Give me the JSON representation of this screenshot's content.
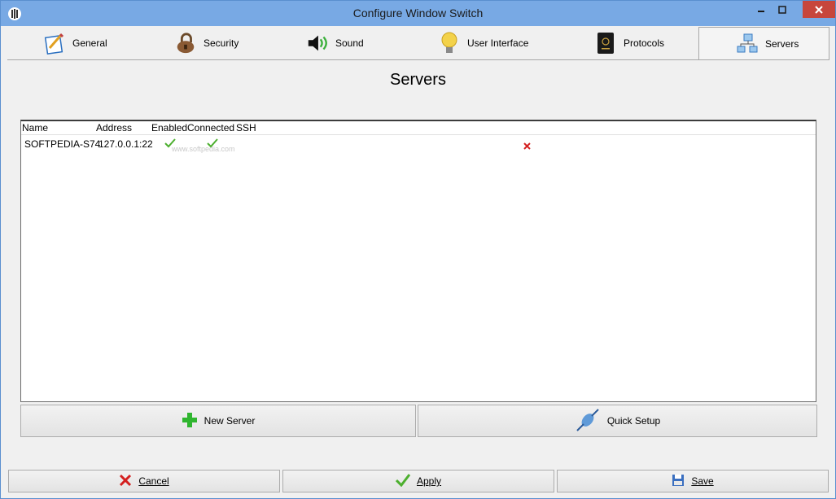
{
  "window": {
    "title": "Configure Window Switch"
  },
  "tabs": [
    {
      "label": "General",
      "icon": "pencil-paper-icon"
    },
    {
      "label": "Security",
      "icon": "padlock-icon"
    },
    {
      "label": "Sound",
      "icon": "speaker-icon"
    },
    {
      "label": "User Interface",
      "icon": "lightbulb-icon"
    },
    {
      "label": "Protocols",
      "icon": "passport-icon"
    },
    {
      "label": "Servers",
      "icon": "network-icon"
    }
  ],
  "active_tab": "Servers",
  "page": {
    "title": "Servers"
  },
  "server_list": {
    "columns": [
      "Name",
      "Address",
      "Enabled",
      "Connected",
      "SSH"
    ],
    "rows": [
      {
        "name": "SOFTPEDIA-S74",
        "address": "127.0.0.1:22",
        "enabled": true,
        "connected": true,
        "ssh": false
      }
    ],
    "watermark": "www.softpedia.com"
  },
  "actions": {
    "new_server": "New Server",
    "quick_setup": "Quick Setup"
  },
  "footer": {
    "cancel": "Cancel",
    "apply": "Apply",
    "save": "Save"
  },
  "colors": {
    "titlebar": "#78a9e4",
    "close": "#c7463c",
    "check": "#4caf2e",
    "cross": "#d42020",
    "plus": "#2fb52f"
  }
}
